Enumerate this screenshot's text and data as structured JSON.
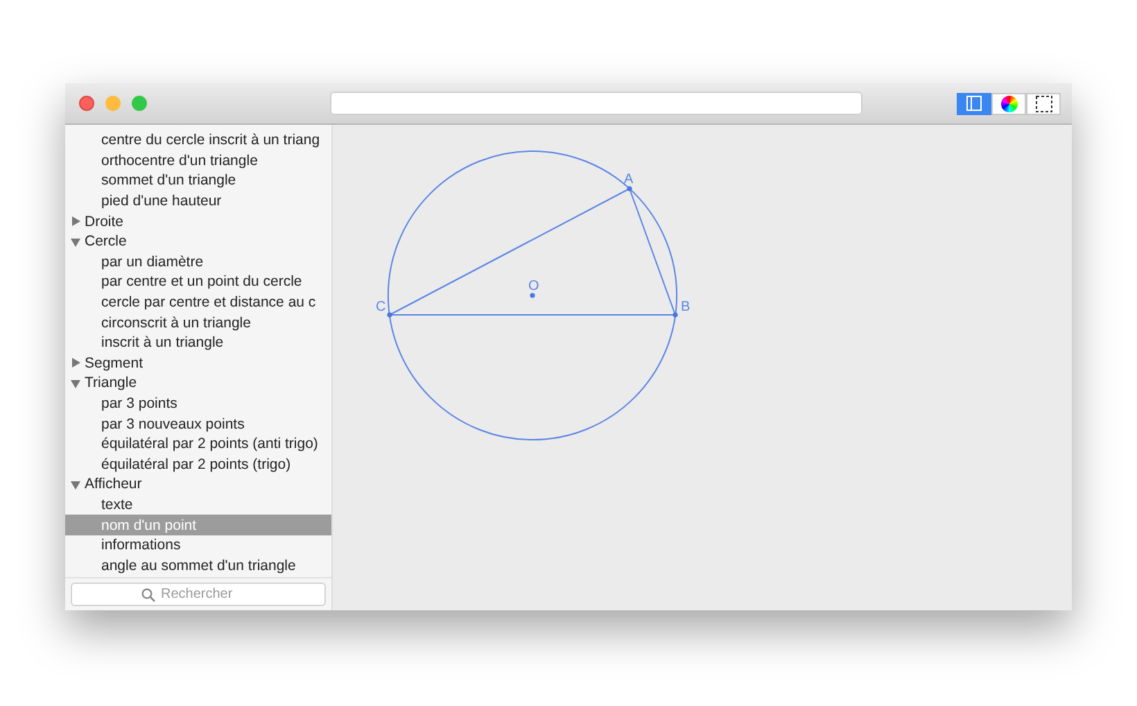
{
  "toolbar": {
    "segments": [
      {
        "kind": "sidebar",
        "selected": true
      },
      {
        "kind": "colors",
        "selected": false
      },
      {
        "kind": "selection",
        "selected": false
      }
    ]
  },
  "sidebar": {
    "continued_items": [
      {
        "label": "centre du cercle inscrit à un triang",
        "selected": false
      },
      {
        "label": "orthocentre d'un triangle",
        "selected": false
      },
      {
        "label": "sommet d'un triangle",
        "selected": false
      },
      {
        "label": "pied d'une hauteur",
        "selected": false
      }
    ],
    "groups": [
      {
        "label": "Droite",
        "expanded": false
      },
      {
        "label": "Cercle",
        "expanded": true,
        "children": [
          {
            "label": "par un diamètre",
            "selected": false
          },
          {
            "label": "par centre et un point du cercle",
            "selected": false
          },
          {
            "label": "cercle par centre et distance au c",
            "selected": false
          },
          {
            "label": "circonscrit à un triangle",
            "selected": false
          },
          {
            "label": "inscrit à un triangle",
            "selected": false
          }
        ]
      },
      {
        "label": "Segment",
        "expanded": false
      },
      {
        "label": "Triangle",
        "expanded": true,
        "children": [
          {
            "label": "par 3 points",
            "selected": false
          },
          {
            "label": "par 3 nouveaux points",
            "selected": false
          },
          {
            "label": "équilatéral par 2 points (anti trigo)",
            "selected": false
          },
          {
            "label": "équilatéral par 2 points (trigo)",
            "selected": false
          }
        ]
      },
      {
        "label": "Afficheur",
        "expanded": true,
        "children": [
          {
            "label": "texte",
            "selected": false
          },
          {
            "label": "nom d'un point",
            "selected": true
          },
          {
            "label": "informations",
            "selected": false
          },
          {
            "label": "angle au sommet d'un triangle",
            "selected": false
          }
        ]
      }
    ],
    "search": {
      "placeholder": "Rechercher"
    }
  },
  "canvas": {
    "points": [
      {
        "label": "A"
      },
      {
        "label": "B"
      },
      {
        "label": "C"
      },
      {
        "label": "O"
      }
    ]
  }
}
